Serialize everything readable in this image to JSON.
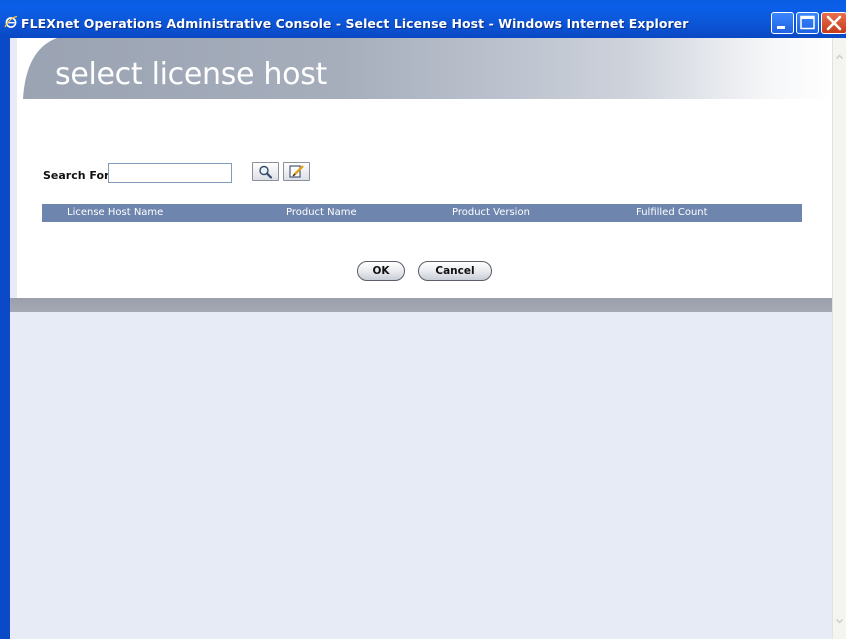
{
  "window": {
    "title": "FLEXnet Operations Administrative Console - Select License Host - Windows Internet Explorer",
    "icon": "ie-icon"
  },
  "header": {
    "title": "select license host"
  },
  "search": {
    "label": "Search For",
    "value": "",
    "placeholder": ""
  },
  "table": {
    "columns": [
      "License Host Name",
      "Product Name",
      "Product Version",
      "Fulfilled Count"
    ],
    "rows": []
  },
  "buttons": {
    "ok": "OK",
    "cancel": "Cancel"
  },
  "colors": {
    "titlebar": "#0b5fe8",
    "table_header": "#6e85ae",
    "page_bg": "#e7ebf6"
  }
}
